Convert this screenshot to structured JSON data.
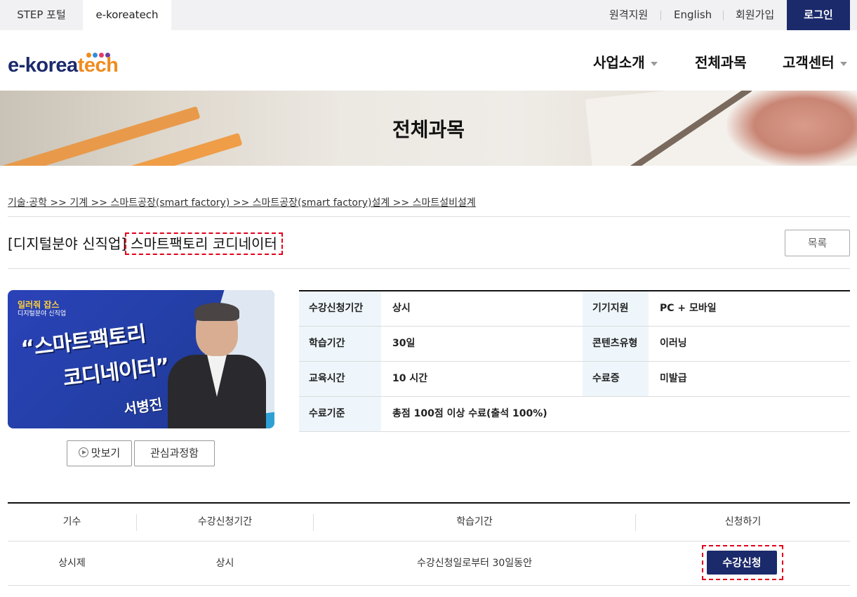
{
  "topbar": {
    "tabs": [
      "STEP 포털",
      "e-koreatech"
    ],
    "util_links": [
      "원격지원",
      "English",
      "회원가입"
    ],
    "login_label": "로그인"
  },
  "header": {
    "logo_part1": "e-korea",
    "logo_part2": "tech",
    "logo_dot_colors": [
      "#f08c1e",
      "#2f8fd8",
      "#e23b6b",
      "#6b3fa0"
    ],
    "nav": [
      "사업소개",
      "전체과목",
      "고객센터"
    ]
  },
  "banner": {
    "title": "전체과목"
  },
  "breadcrumb": "기술·공학 >> 기계 >> 스마트공장(smart factory) >> 스마트공장(smart factory)설계 >> 스마트설비설계",
  "course": {
    "category": "[디지털분야 신직업]",
    "name": "스마트팩토리 코디네이터",
    "list_button": "목록"
  },
  "thumbnail": {
    "badge_line1": "일러줘 잡스",
    "badge_line2": "디지털분야 신직업",
    "headline_line1": "“스마트팩토리",
    "headline_line2": "코디네이터”",
    "instructor": "서병진"
  },
  "buttons": {
    "preview": "맛보기",
    "favorite": "관심과정함"
  },
  "info_rows": [
    {
      "label1": "수강신청기간",
      "value1": "상시",
      "label2": "기기지원",
      "value2": "PC + 모바일"
    },
    {
      "label1": "학습기간",
      "value1": "30일",
      "label2": "콘텐츠유형",
      "value2": "이러닝"
    },
    {
      "label1": "교육시간",
      "value1": "10 시간",
      "label2": "수료증",
      "value2": "미발급"
    },
    {
      "label1": "수료기준",
      "value1": "총점 100점 이상 수료(출석 100%)",
      "label2": "",
      "value2": ""
    }
  ],
  "schedule": {
    "headers": [
      "기수",
      "수강신청기간",
      "학습기간",
      "신청하기"
    ],
    "row": {
      "term": "상시제",
      "apply_period": "상시",
      "study_period": "수강신청일로부터 30일동안",
      "apply_button": "수강신청"
    }
  }
}
